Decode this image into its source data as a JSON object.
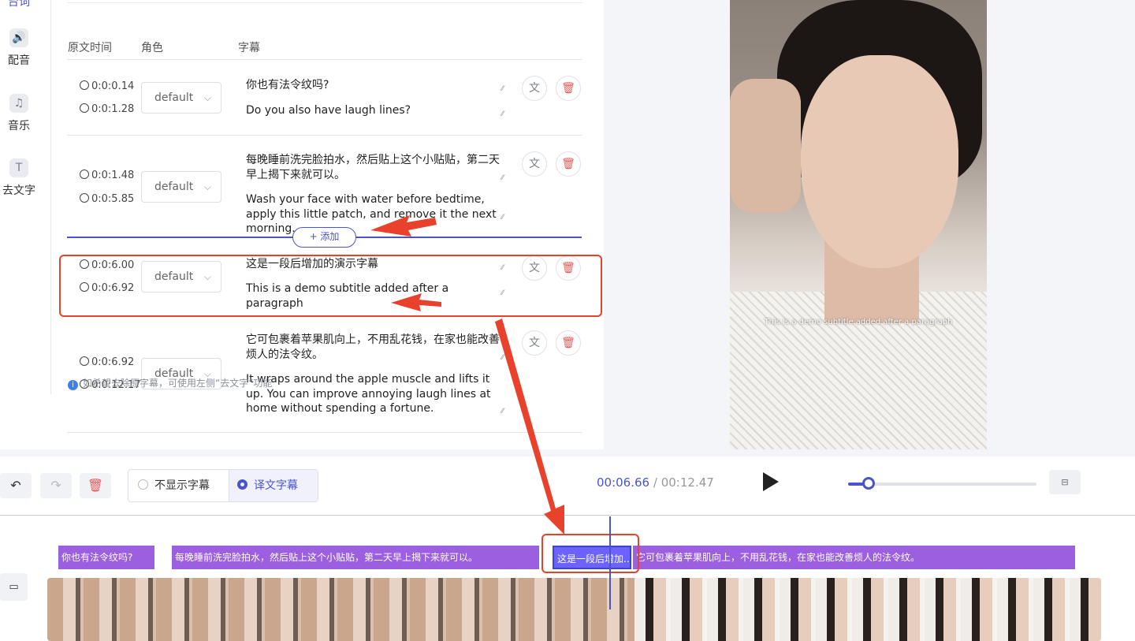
{
  "rail": {
    "top_partial_label": "台词",
    "items": [
      {
        "label": "配音",
        "icon": "voice-icon"
      },
      {
        "label": "音乐",
        "icon": "music-icon"
      },
      {
        "label": "去文字",
        "icon": "remove-text-icon"
      }
    ]
  },
  "table": {
    "headers": {
      "time": "原文时间",
      "role": "角色",
      "subtitle": "字幕"
    },
    "rows": [
      {
        "start": "0:0:0.14",
        "end": "0:0:1.28",
        "role": "default",
        "original": "你也有法令纹吗?",
        "translation": "Do you also have laugh lines?"
      },
      {
        "start": "0:0:1.48",
        "end": "0:0:5.85",
        "role": "default",
        "original": "每晚睡前洗完脸拍水，然后贴上这个小贴贴，第二天早上揭下来就可以。",
        "translation": "Wash your face with water before bedtime, apply this little patch, and remove it the next morning."
      },
      {
        "start": "0:0:6.00",
        "end": "0:0:6.92",
        "role": "default",
        "original": "这是一段后增加的演示字幕",
        "translation": "This is a demo subtitle added after a paragraph"
      },
      {
        "start": "0:0:6.92",
        "end": "0:0:12.17",
        "role": "default",
        "original": "它可包裹着苹果肌向上，不用乱花钱，在家也能改善烦人的法令纹。",
        "translation": "It wraps around the apple muscle and lifts it up. You can improve annoying laugh lines at home without spending a fortune."
      }
    ],
    "add_label": "+ 添加"
  },
  "hint": {
    "text": "如希望去除原字幕，可使用左侧“去文字”功能"
  },
  "preview": {
    "subtitle_overlay": "This is a demo subtitle added after a paragraph"
  },
  "toolbar": {
    "undo": "↶",
    "redo": "↷",
    "delete": "🗑",
    "mode_none": "不显示字幕",
    "mode_translated": "译文字幕",
    "current_time": "00:06.66",
    "separator": "/",
    "total_time": "00:12.47",
    "zoom_progress": 0.11,
    "fit_icon": "fit-icon"
  },
  "timeline": {
    "captions": [
      "你也有法令纹吗?",
      "每晚睡前洗完脸拍水，然后贴上这个小贴贴，第二天早上揭下来就可以。",
      "这是一段后增加...",
      "它可包裹着苹果肌向上，不用乱花钱，在家也能改善烦人的法令纹。"
    ],
    "video_icon": "video-camera-icon"
  },
  "colors": {
    "accent": "#4b55c9",
    "caption": "#9b5fe0",
    "annotation": "#e8412c",
    "delete": "#e55a5a"
  }
}
